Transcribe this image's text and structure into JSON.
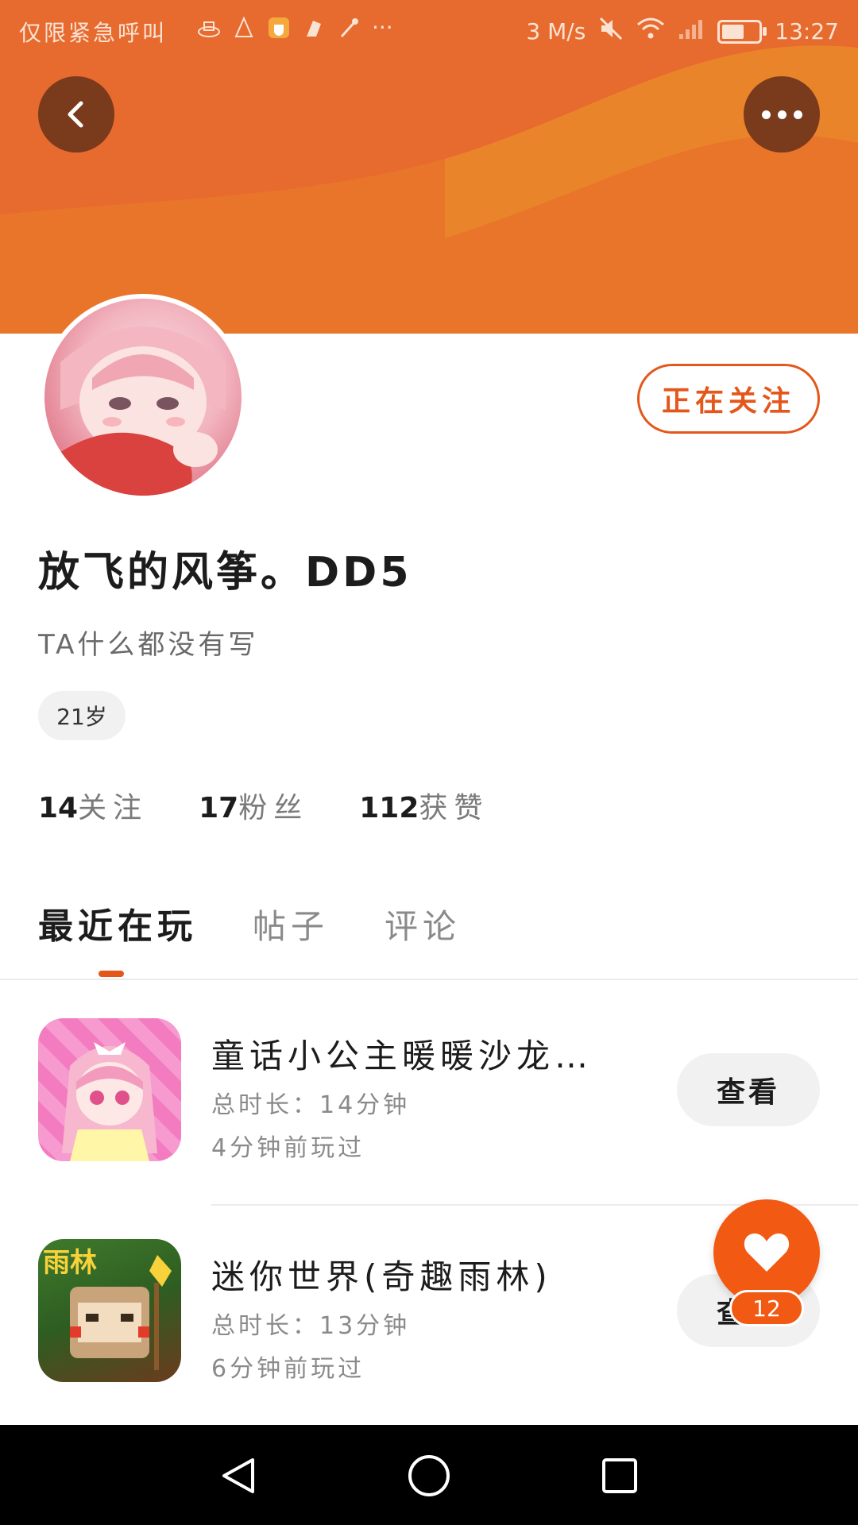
{
  "status_bar": {
    "carrier": "仅限紧急呼叫",
    "more": "···",
    "speed": "3 M/s",
    "battery_level": 0.6,
    "time": "13:27"
  },
  "header": {
    "back_icon": "chevron-left-icon",
    "more_icon": "more-horizontal-icon"
  },
  "profile": {
    "follow_button": "正在关注",
    "username": "放飞的风筝。DD5",
    "bio": "TA什么都没有写",
    "age": "21岁",
    "stats": [
      {
        "num": "14",
        "label": "关注"
      },
      {
        "num": "17",
        "label": "粉丝"
      },
      {
        "num": "112",
        "label": "获赞"
      }
    ]
  },
  "tabs": [
    {
      "label": "最近在玩",
      "active": true
    },
    {
      "label": "帖子",
      "active": false
    },
    {
      "label": "评论",
      "active": false
    }
  ],
  "games": [
    {
      "title": "童话小公主暖暖沙龙时…",
      "duration": "总时长：14分钟",
      "last_played": "4分钟前玩过",
      "button": "查看"
    },
    {
      "title": "迷你世界(奇趣雨林)",
      "icon_text": "雨林",
      "duration": "总时长：13分钟",
      "last_played": "6分钟前玩过",
      "button": "查看"
    }
  ],
  "like_fab": {
    "icon": "heart-icon",
    "count": "12"
  },
  "colors": {
    "accent": "#e4571b",
    "banner": "#e8682c"
  }
}
